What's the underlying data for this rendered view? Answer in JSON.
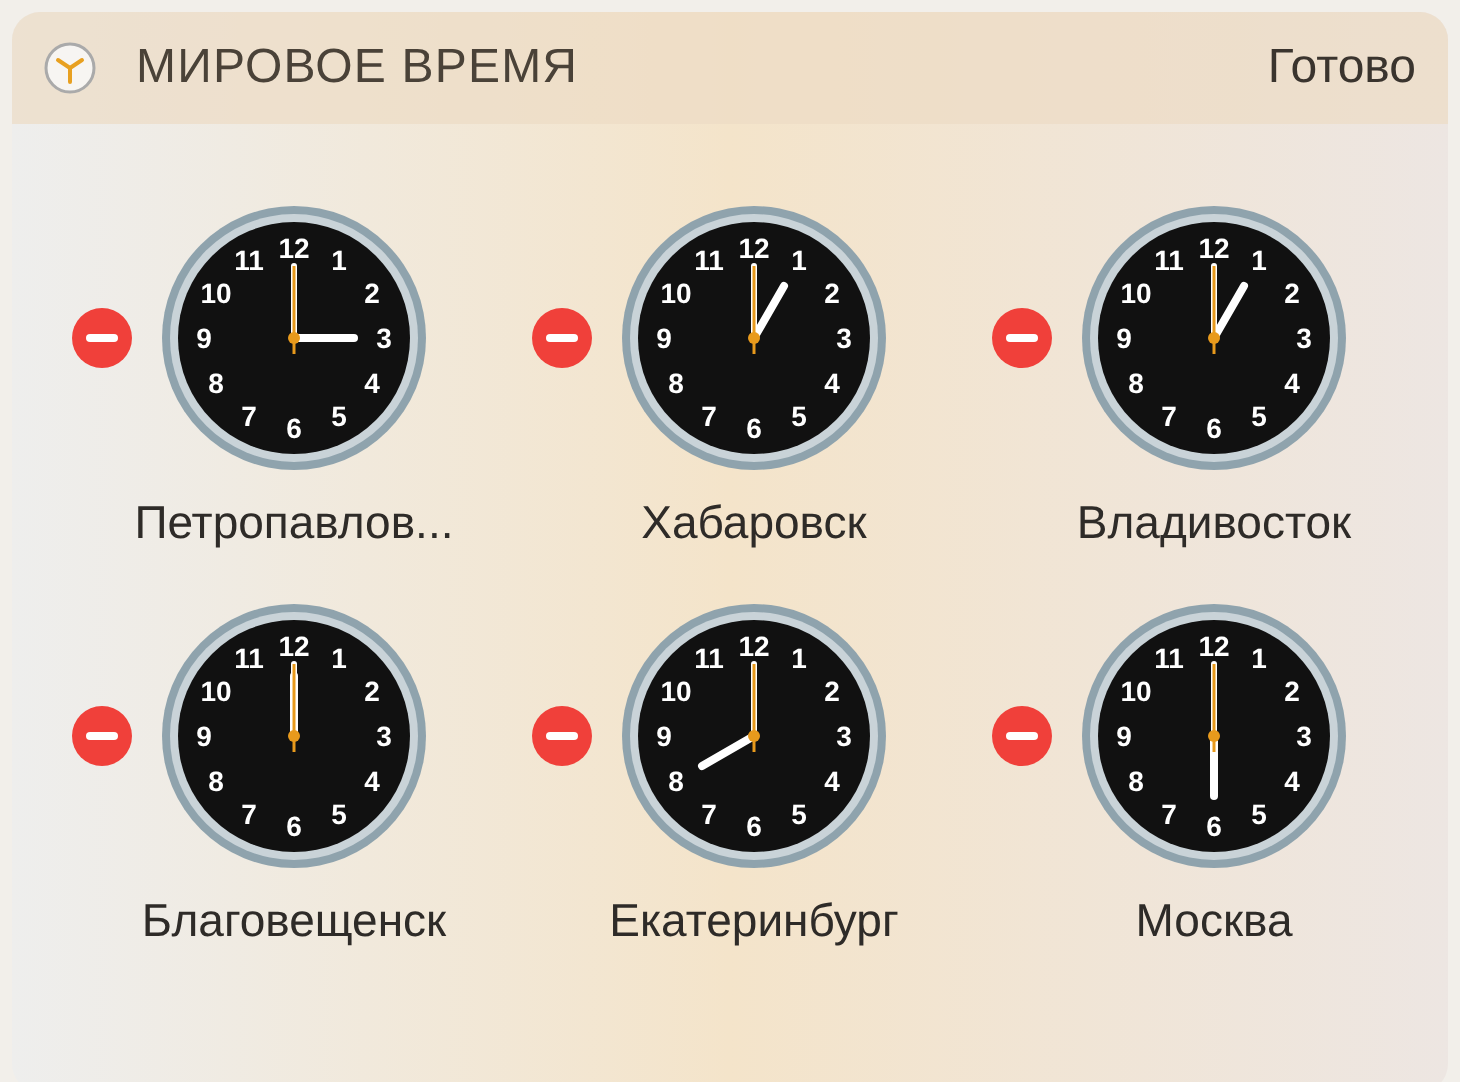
{
  "widget": {
    "title": "МИРОВОЕ ВРЕМЯ",
    "done_button": "Готово"
  },
  "clocks": [
    {
      "city": "Петропавлов...",
      "numbers": [
        "12",
        "11",
        "1",
        "10",
        "2",
        "9",
        "3",
        "8",
        "4",
        "7",
        "5",
        "6"
      ]
    },
    {
      "city": "Хабаровск",
      "numbers": [
        "12",
        "11",
        "1",
        "10",
        "2",
        "9",
        "3",
        "8",
        "4",
        "7",
        "5",
        "6"
      ]
    },
    {
      "city": "Владивосток",
      "numbers": [
        "12",
        "11",
        "1",
        "10",
        "2",
        "9",
        "3",
        "8",
        "4",
        "7",
        "5",
        "6"
      ]
    },
    {
      "city": "Благовещенск",
      "numbers": [
        "12",
        "11",
        "1",
        "10",
        "2",
        "9",
        "3",
        "8",
        "4",
        "7",
        "5",
        "6"
      ]
    },
    {
      "city": "Екатеринбург",
      "numbers": [
        "12",
        "11",
        "1",
        "10",
        "2",
        "9",
        "3",
        "8",
        "4",
        "7",
        "5",
        "6"
      ]
    },
    {
      "city": "Москва",
      "numbers": [
        "12",
        "11",
        "1",
        "10",
        "2",
        "9",
        "3",
        "8",
        "4",
        "7",
        "5",
        "6"
      ]
    }
  ]
}
